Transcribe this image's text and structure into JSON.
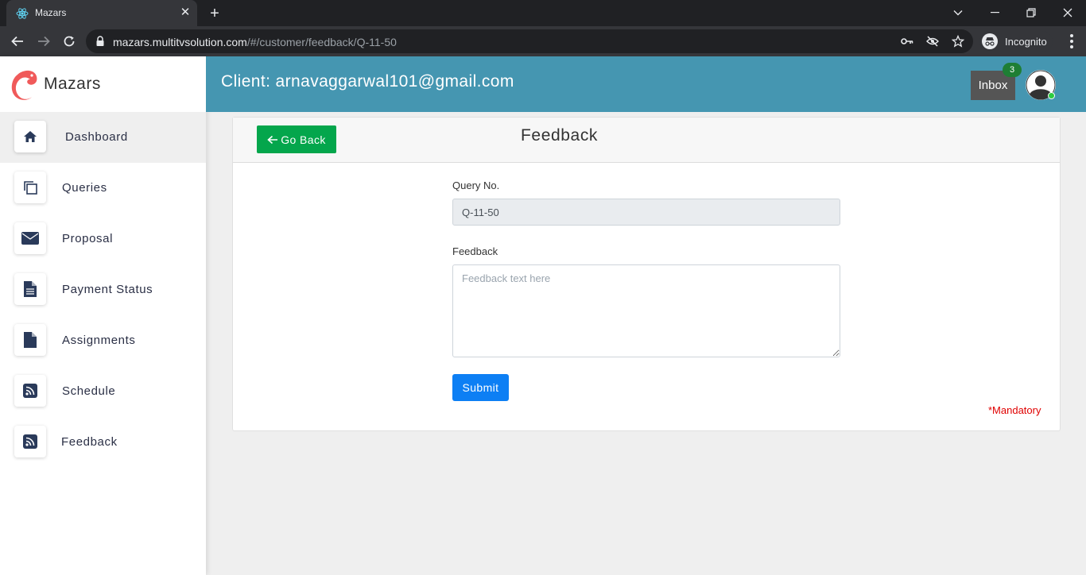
{
  "browser": {
    "tab_title": "Mazars",
    "url_host": "mazars.multitvsolution.com",
    "url_path": "/#/customer/feedback/Q-11-50",
    "incognito_label": "Incognito"
  },
  "sidebar": {
    "brand": "Mazars",
    "items": [
      {
        "label": "Dashboard",
        "icon": "home-icon",
        "active": true
      },
      {
        "label": "Queries",
        "icon": "copy-icon"
      },
      {
        "label": "Proposal",
        "icon": "envelope-icon"
      },
      {
        "label": "Payment Status",
        "icon": "document-icon"
      },
      {
        "label": "Assignments",
        "icon": "file-icon"
      },
      {
        "label": "Schedule",
        "icon": "rss-icon"
      },
      {
        "label": "Feedback",
        "icon": "rss-icon"
      }
    ]
  },
  "header": {
    "title": "Client: arnavaggarwal101@gmail.com",
    "inbox_label": "Inbox",
    "inbox_count": "3"
  },
  "card": {
    "go_back_label": "Go Back",
    "title": "Feedback",
    "query_label": "Query No.",
    "query_value": "Q-11-50",
    "feedback_label": "Feedback",
    "feedback_placeholder": "Feedback text here",
    "submit_label": "Submit",
    "mandatory_note": "*Mandatory"
  },
  "colors": {
    "header_bg": "#4596b1",
    "go_back_bg": "#04a64c",
    "submit_bg": "#0d7ff4",
    "mandatory": "#e00000",
    "brand_logo": "#f05a5a"
  }
}
